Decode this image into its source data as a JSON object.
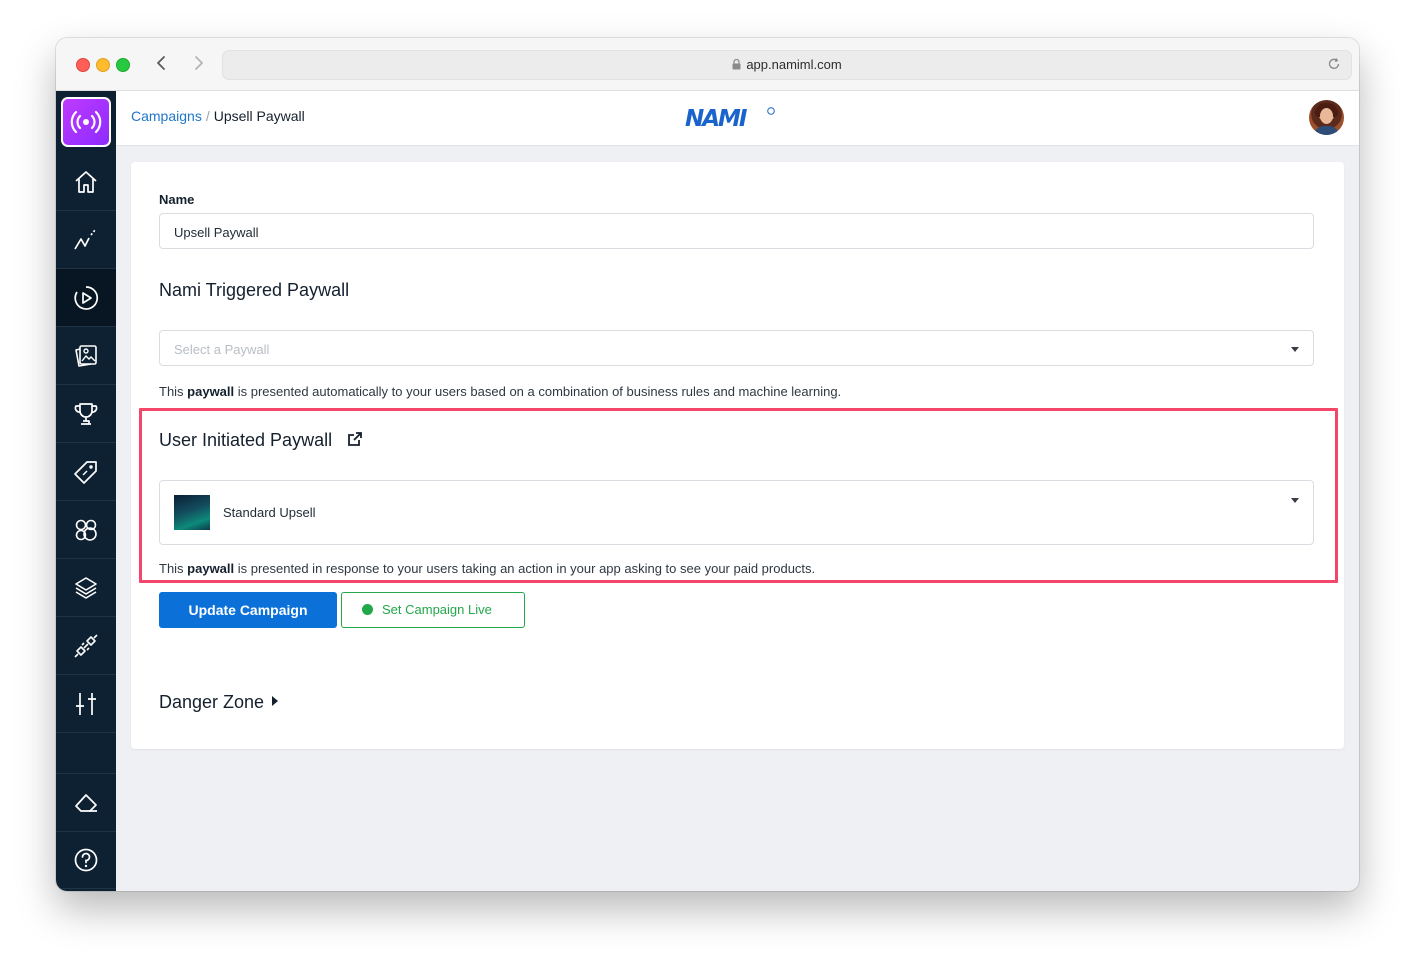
{
  "browser": {
    "url": "app.namiml.com",
    "lock_icon": "lock-icon",
    "reload_icon": "reload-icon"
  },
  "sidebar": {
    "logo_icon": "broadcast-icon",
    "items": [
      {
        "icon": "home-icon"
      },
      {
        "icon": "analytics-icon"
      },
      {
        "icon": "campaigns-icon",
        "active": true
      },
      {
        "icon": "paywalls-icon"
      },
      {
        "icon": "trophy-icon"
      },
      {
        "icon": "tag-icon"
      },
      {
        "icon": "users-icon"
      },
      {
        "icon": "layers-icon"
      },
      {
        "icon": "integrations-icon"
      },
      {
        "icon": "settings-sliders-icon"
      }
    ],
    "bottom_items": [
      {
        "icon": "eraser-icon"
      },
      {
        "icon": "help-icon"
      }
    ]
  },
  "header": {
    "breadcrumb": {
      "parent": "Campaigns",
      "separator": "/",
      "current": "Upsell Paywall"
    },
    "brand": "NAMI"
  },
  "form": {
    "name_label": "Name",
    "name_value": "Upsell Paywall",
    "triggered_title": "Nami Triggered Paywall",
    "triggered_placeholder": "Select a Paywall",
    "triggered_help_pre": "This ",
    "triggered_help_bold": "paywall",
    "triggered_help_post": " is presented automatically to your users based on a combination of business rules and machine learning.",
    "user_title": "User Initiated Paywall",
    "user_selected": "Standard Upsell",
    "user_help_pre": "This ",
    "user_help_bold": "paywall",
    "user_help_post": " is presented in response to your users taking an action in your app asking to see your paid products.",
    "update_button": "Update Campaign",
    "live_button": "Set Campaign Live",
    "danger_zone": "Danger Zone"
  },
  "colors": {
    "accent": "#0b71d9",
    "link": "#1f77c9",
    "live_green": "#22a74a",
    "highlight": "#f3476a",
    "sidebar_bg": "#0e2133"
  }
}
